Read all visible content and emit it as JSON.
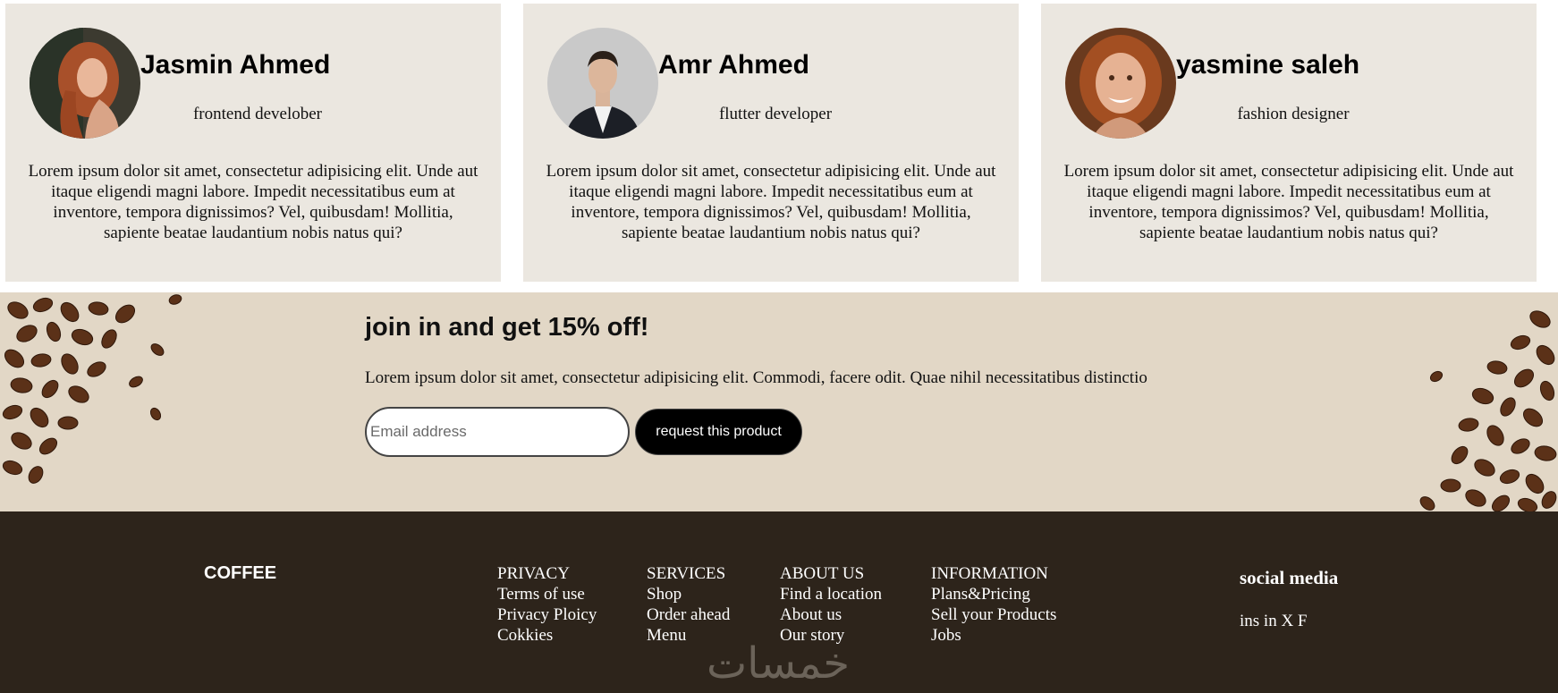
{
  "testimonials": [
    {
      "name": "Jasmin Ahmed",
      "role": "frontend develober",
      "text": "Lorem ipsum dolor sit amet, consectetur adipisicing elit. Unde aut itaque eligendi magni labore. Impedit necessitatibus eum at inventore, tempora dignissimos? Vel, quibusdam! Mollitia, sapiente beatae laudantium nobis natus qui?"
    },
    {
      "name": "Amr Ahmed",
      "role": "flutter developer",
      "text": "Lorem ipsum dolor sit amet, consectetur adipisicing elit. Unde aut itaque eligendi magni labore. Impedit necessitatibus eum at inventore, tempora dignissimos? Vel, quibusdam! Mollitia, sapiente beatae laudantium nobis natus qui?"
    },
    {
      "name": "yasmine saleh",
      "role": "fashion designer",
      "text": "Lorem ipsum dolor sit amet, consectetur adipisicing elit. Unde aut itaque eligendi magni labore. Impedit necessitatibus eum at inventore, tempora dignissimos? Vel, quibusdam! Mollitia, sapiente beatae laudantium nobis natus qui?"
    }
  ],
  "promo": {
    "title": "join in and get 15% off!",
    "text": "Lorem ipsum dolor sit amet, consectetur adipisicing elit. Commodi, facere odit. Quae nihil necessitatibus distinctio",
    "email_placeholder": "Email address",
    "button_label": "request this product"
  },
  "footer": {
    "brand": "COFFEE",
    "columns": [
      {
        "title": "PRIVACY",
        "links": [
          "Terms of use",
          "Privacy Ploicy",
          "Cokkies"
        ]
      },
      {
        "title": "SERVICES",
        "links": [
          "Shop",
          "Order ahead",
          "Menu"
        ]
      },
      {
        "title": "ABOUT US",
        "links": [
          "Find a location",
          "About us",
          "Our story"
        ]
      },
      {
        "title": "INFORMATION",
        "links": [
          "Plans&Pricing",
          "Sell your Products",
          "Jobs"
        ]
      }
    ],
    "social_title": "social media",
    "social_links": "ins in X F",
    "watermark": "خمسات"
  },
  "colors": {
    "card_bg": "#ebe7e0",
    "promo_bg": "#e2d7c6",
    "footer_bg": "#2d241b",
    "button_bg": "#000000"
  }
}
